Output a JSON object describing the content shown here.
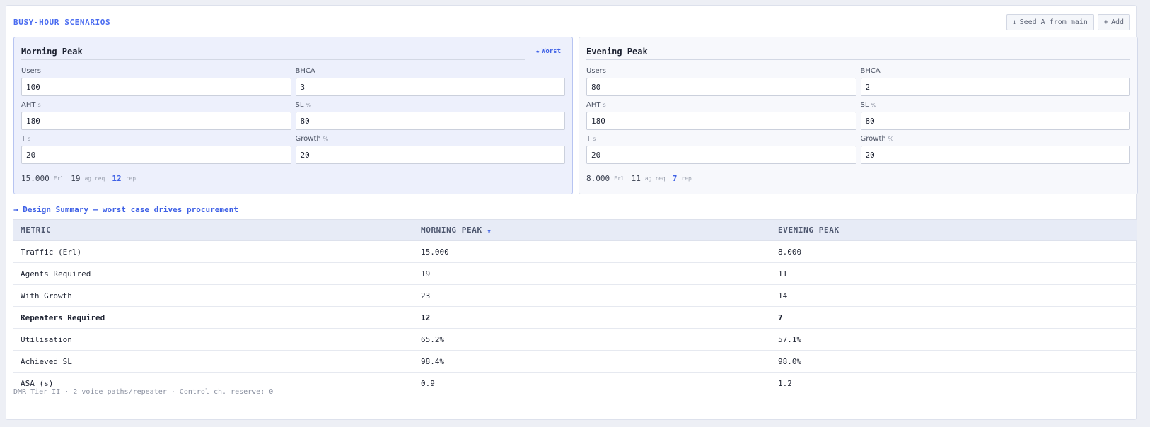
{
  "header": {
    "title": "BUSY-HOUR SCENARIOS",
    "seed_label": "Seed A from main",
    "seed_icon": "↓",
    "add_label": "Add",
    "add_icon": "+"
  },
  "scenarios": [
    {
      "name": "Morning Peak",
      "worst": true,
      "worst_label": "Worst",
      "worst_icon": "★",
      "fields": {
        "users": {
          "label": "Users",
          "unit": "",
          "value": "100"
        },
        "bhca": {
          "label": "BHCA",
          "unit": "",
          "value": "3"
        },
        "aht": {
          "label": "AHT",
          "unit": "s",
          "value": "180"
        },
        "sl": {
          "label": "SL",
          "unit": "%",
          "value": "80"
        },
        "t": {
          "label": "T",
          "unit": "s",
          "value": "20"
        },
        "growth": {
          "label": "Growth",
          "unit": "%",
          "value": "20"
        }
      },
      "summary": {
        "erl": "15.000",
        "erl_unit": "Erl",
        "ag": "19",
        "ag_unit": "ag req",
        "rep": "12",
        "rep_unit": "rep"
      }
    },
    {
      "name": "Evening Peak",
      "worst": false,
      "fields": {
        "users": {
          "label": "Users",
          "unit": "",
          "value": "80"
        },
        "bhca": {
          "label": "BHCA",
          "unit": "",
          "value": "2"
        },
        "aht": {
          "label": "AHT",
          "unit": "s",
          "value": "180"
        },
        "sl": {
          "label": "SL",
          "unit": "%",
          "value": "80"
        },
        "t": {
          "label": "T",
          "unit": "s",
          "value": "20"
        },
        "growth": {
          "label": "Growth",
          "unit": "%",
          "value": "20"
        }
      },
      "summary": {
        "erl": "8.000",
        "erl_unit": "Erl",
        "ag": "11",
        "ag_unit": "ag req",
        "rep": "7",
        "rep_unit": "rep"
      }
    }
  ],
  "design_summary": {
    "title": "→ Design Summary — worst case drives procurement",
    "headers": [
      "METRIC",
      "MORNING PEAK",
      "EVENING PEAK"
    ],
    "worst_marker": "★",
    "rows": [
      {
        "metric": "Traffic (Erl)",
        "a": "15.000",
        "b": "8.000",
        "bold": false
      },
      {
        "metric": "Agents Required",
        "a": "19",
        "b": "11",
        "bold": false
      },
      {
        "metric": "With Growth",
        "a": "23",
        "b": "14",
        "bold": false
      },
      {
        "metric": "Repeaters Required",
        "a": "12",
        "b": "7",
        "bold": true
      },
      {
        "metric": "Utilisation",
        "a": "65.2%",
        "b": "57.1%",
        "bold": false
      },
      {
        "metric": "Achieved SL",
        "a": "98.4%",
        "b": "98.0%",
        "bold": false
      },
      {
        "metric": "ASA (s)",
        "a": "0.9",
        "b": "1.2",
        "bold": false
      }
    ]
  },
  "footnote": "DMR Tier II · 2 voice paths/repeater · Control ch. reserve: 0",
  "colors": {
    "accent": "#3f61e6",
    "worst_card_bg": "#edf0fc"
  }
}
